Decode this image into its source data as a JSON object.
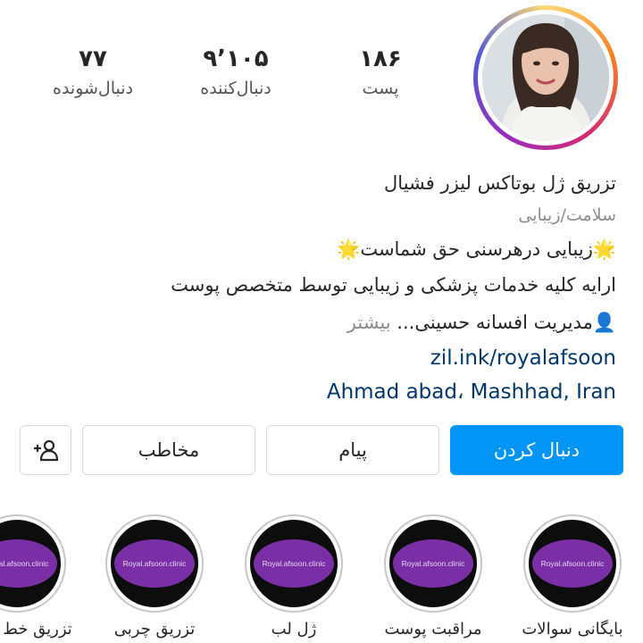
{
  "stats": [
    {
      "value": "۷۷",
      "label": "دنبال‌شونده"
    },
    {
      "value": "۹٬۱۰۵",
      "label": "دنبال‌کننده"
    },
    {
      "value": "۱۸۶",
      "label": "پست"
    }
  ],
  "bio": {
    "name": "تزریق ژل بوتاکس لیزر فشیال",
    "category": "سلامت/زیبایی",
    "line1": "🌟زیبایی درهرسنی حق شماست🌟",
    "line2": "ارایه کلیه خدمات پزشکی و زیبایی توسط متخصص پوست",
    "line3": "👤مدیریت افسانه حسینی...",
    "more": "بیشتر",
    "link": "zil.ink/royalafsoon",
    "location": "Ahmad abad، Mashhad, Iran"
  },
  "buttons": {
    "follow": "دنبال کردن",
    "message": "پیام",
    "contact": "مخاطب"
  },
  "icons": {
    "add_person": "add-person-icon"
  },
  "highlights": [
    {
      "text": "Royal.afsoon.clinic",
      "label": "بایگانی سوالات"
    },
    {
      "text": "Royal.afsoon.clinic",
      "label": "مراقبت پوست"
    },
    {
      "text": "Royal.afsoon.clinic",
      "label": "ژل لب"
    },
    {
      "text": "Royal.afsoon.clinic",
      "label": "تزریق چربی"
    },
    {
      "text": "Royal.afsoon.clinic",
      "label": "تزریق خط"
    }
  ],
  "colors": {
    "follow_button": "#0095f6",
    "highlight": "#7a2fa6",
    "link": "#00376b"
  }
}
